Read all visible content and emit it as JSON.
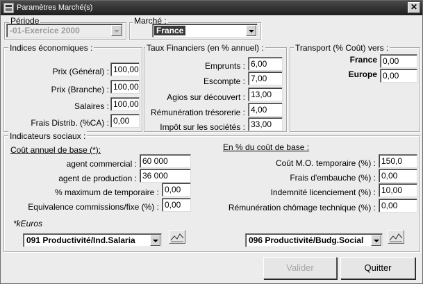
{
  "window": {
    "title": "Paramètres Marché(s)"
  },
  "periode": {
    "label": "Période",
    "value": "-01-Exercice 2000"
  },
  "marche": {
    "label": "Marché :",
    "value": "France"
  },
  "indices": {
    "legend": "Indices économiques :",
    "rows": [
      {
        "label": "Prix  (Général) :",
        "value": "100,00"
      },
      {
        "label": "Prix  (Branche) :",
        "value": "100,00"
      },
      {
        "label": "Salaires :",
        "value": "100,00"
      },
      {
        "label": "Frais Distrib. (%CA) :",
        "value": "0,00"
      }
    ]
  },
  "taux": {
    "legend": "Taux Financiers (en % annuel) :",
    "rows": [
      {
        "label": "Emprunts :",
        "value": "6,00"
      },
      {
        "label": "Escompte :",
        "value": "7,00"
      },
      {
        "label": "Agios sur découvert :",
        "value": "13,00"
      },
      {
        "label": "Rémunération trésorerie :",
        "value": "4,00"
      },
      {
        "label": "Impôt sur les sociétés :",
        "value": "33,00"
      }
    ]
  },
  "transport": {
    "legend": "Transport (% Coût) vers :",
    "rows": [
      {
        "label": "France",
        "value": "0,00"
      },
      {
        "label": "Europe",
        "value": "0,00"
      }
    ]
  },
  "social": {
    "legend": "Indicateurs sociaux :",
    "left_title": "Coût annuel  de base (*):",
    "left_rows": [
      {
        "label": "agent commercial :",
        "value": "60 000"
      },
      {
        "label": "agent de production :",
        "value": "36 000"
      },
      {
        "label": "%  maximum de temporaire :",
        "value": "0,00"
      },
      {
        "label": "Equivalence commissions/fixe (%) :",
        "value": "0,00"
      }
    ],
    "right_title": "En % du coût de base :",
    "right_rows": [
      {
        "label": "Coût M.O. temporaire (%) :",
        "value": "150,0"
      },
      {
        "label": "Frais d'embauche (%) :",
        "value": "0,00"
      },
      {
        "label": "Indemnité licenciement (%) :",
        "value": "10,00"
      },
      {
        "label": "Rémunération chômage technique (%) :",
        "value": "0,00"
      }
    ],
    "footnote": "*kEuros",
    "left_combo": "091 Productivité/Ind.Salaria",
    "right_combo": "096 Productivité/Budg.Social"
  },
  "buttons": {
    "validate": "Valider",
    "quit": "Quitter"
  }
}
